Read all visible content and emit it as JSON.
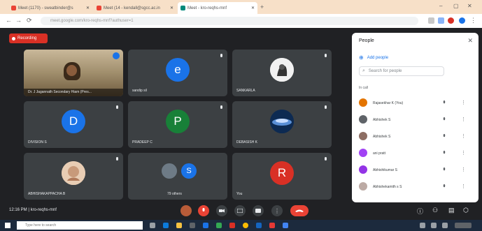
{
  "browser": {
    "tabs": [
      {
        "title": "Meet (1170) - sweatbinder@s",
        "active": false,
        "color": "#ea4335"
      },
      {
        "title": "Meet (14 - kendall@sgcc.ac.in",
        "active": false,
        "color": "#ea4335"
      },
      {
        "title": "Meet - kro-reqhs-mnf",
        "active": true,
        "color": "#00897b"
      }
    ],
    "url": "meet.google.com/kro-reqhs-mnf?authuser=1"
  },
  "recording": {
    "label": "Recording"
  },
  "tiles": [
    {
      "name": "Dr. J Jagannath Secondary Hiam (Pres...",
      "type": "video"
    },
    {
      "name": "sandip sil",
      "type": "letter",
      "letter": "e",
      "color": "#1a73e8"
    },
    {
      "name": "SANKARLA",
      "type": "photo"
    },
    {
      "name": "DIVISION S",
      "type": "letter",
      "letter": "D",
      "color": "#1a73e8"
    },
    {
      "name": "PRADEEP C",
      "type": "letter",
      "letter": "P",
      "color": "#188038"
    },
    {
      "name": "DEBASISH K",
      "type": "photo"
    },
    {
      "name": "ABHISHAKAPPACHA B",
      "type": "photo"
    },
    {
      "name": "79 others",
      "type": "group",
      "letter": "S"
    },
    {
      "name": "You",
      "type": "letter",
      "letter": "R",
      "color": "#d93025"
    }
  ],
  "people_panel": {
    "title": "People",
    "add_people": "Add people",
    "search_placeholder": "Search for people",
    "in_call_label": "In call",
    "people": [
      {
        "name": "Rajasekhar K (You)",
        "color": "#e37400"
      },
      {
        "name": "Abhishek S",
        "color": "#5f6368"
      },
      {
        "name": "Abhishek S",
        "color": "#8d6e63"
      },
      {
        "name": "ani pratt",
        "color": "#a142f4"
      },
      {
        "name": "Abhishikumar S",
        "color": "#9334e6"
      },
      {
        "name": "Abhishekamith s S",
        "color": "#bcaaa4"
      }
    ]
  },
  "meeting_info": {
    "time": "12:16 PM",
    "separator": "|",
    "code": "kro-reqhs-mnf"
  },
  "taskbar": {
    "search_placeholder": "Type here to search"
  }
}
